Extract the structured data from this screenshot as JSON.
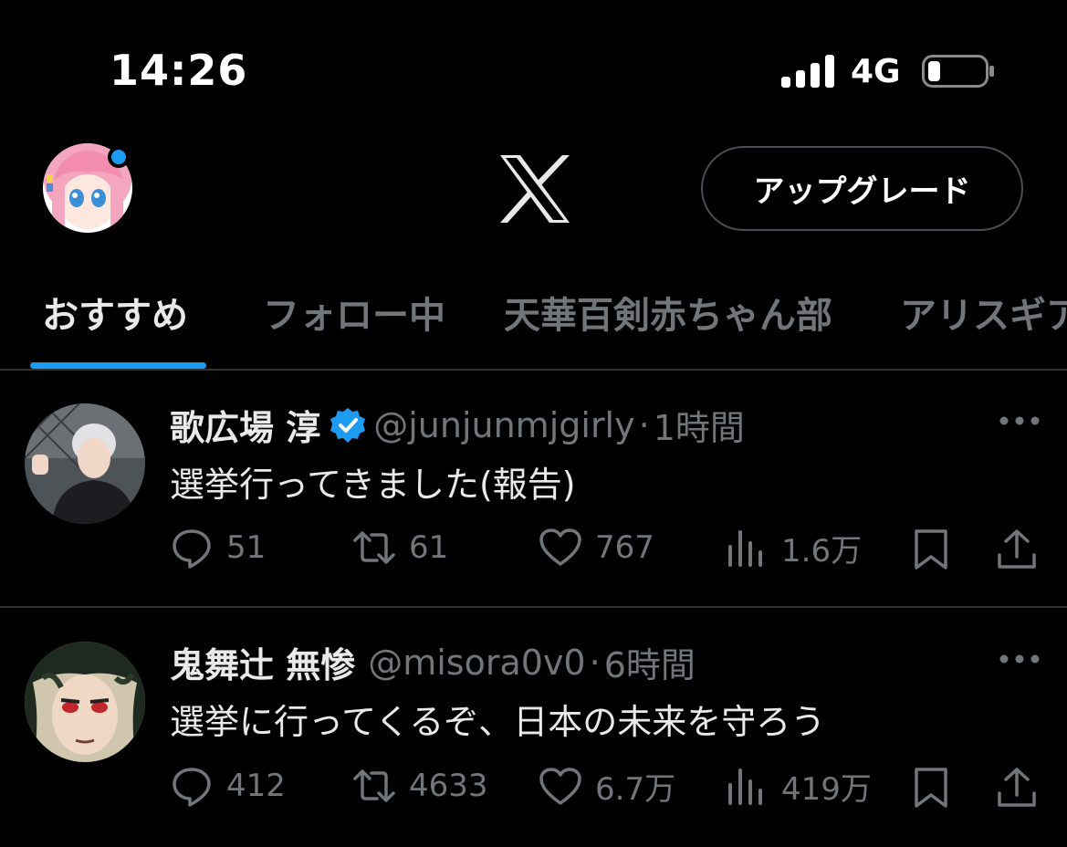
{
  "status_bar": {
    "time": "14:26",
    "network": "4G"
  },
  "header": {
    "upgrade_label": "アップグレード"
  },
  "tabs": [
    {
      "label": "おすすめ",
      "active": true
    },
    {
      "label": "フォロー中",
      "active": false
    },
    {
      "label": "天華百剣赤ちゃん部",
      "active": false
    },
    {
      "label": "アリスギア",
      "active": false
    }
  ],
  "posts": [
    {
      "name": "歌広場 淳",
      "verified": true,
      "handle": "@junjunmjgirly",
      "separator": "·",
      "time": "1時間",
      "text": "選挙行ってきました(報告)",
      "replies": "51",
      "reposts": "61",
      "likes": "767",
      "views": "1.6万"
    },
    {
      "name": "鬼舞辻 無惨",
      "verified": false,
      "handle": "@misora0v0",
      "separator": "·",
      "time": "6時間",
      "text": "選挙に行ってくるぞ、日本の未来を守ろう",
      "replies": "412",
      "reposts": "4633",
      "likes": "6.7万",
      "views": "419万"
    }
  ],
  "colors": {
    "accent": "#1d9bf0",
    "muted": "#71767b",
    "divider": "#2f3336"
  }
}
